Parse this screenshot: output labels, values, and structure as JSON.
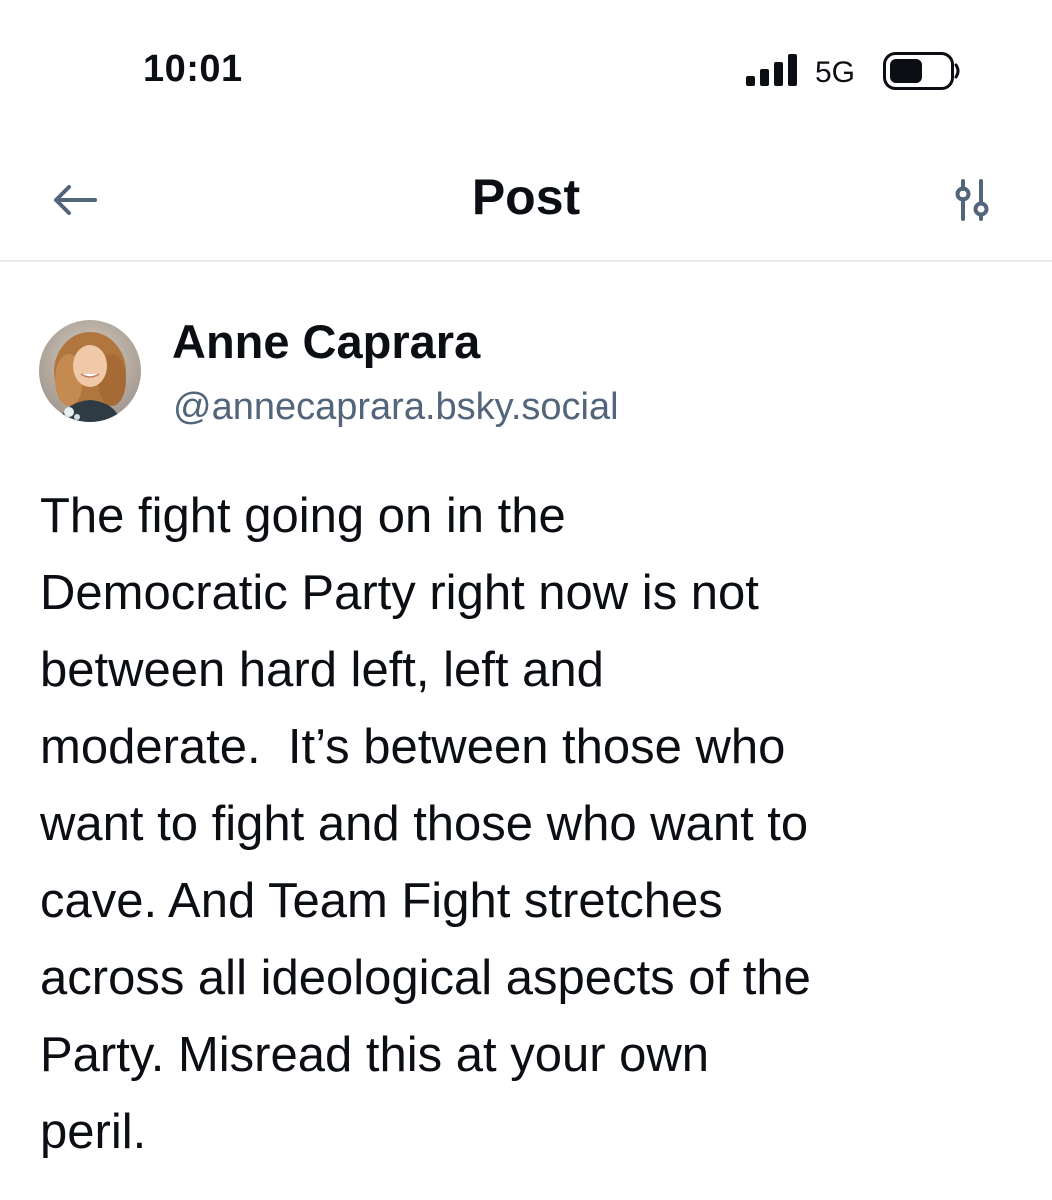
{
  "status_bar": {
    "time": "10:01",
    "network": "5G",
    "signal_icon": "cellular-signal-icon",
    "battery_icon": "battery-icon"
  },
  "nav": {
    "title": "Post",
    "back_icon": "arrow-left-icon",
    "settings_icon": "sliders-icon"
  },
  "post": {
    "author": {
      "display_name": "Anne Caprara",
      "handle": "@annecaprara.bsky.social",
      "avatar_icon": "avatar"
    },
    "text_lines": [
      "The fight going on in the",
      "Democratic Party right now is not",
      "between hard left, left and",
      "moderate.  It’s between those who",
      "want to fight and those who want to",
      "cave. And Team Fight stretches",
      "across all ideological aspects of the",
      "Party. Misread this at your own",
      "peril."
    ]
  },
  "colors": {
    "text": "#0b0f14",
    "secondary_text": "#52657a",
    "icon": "#52657a",
    "divider": "#e7ebef"
  }
}
